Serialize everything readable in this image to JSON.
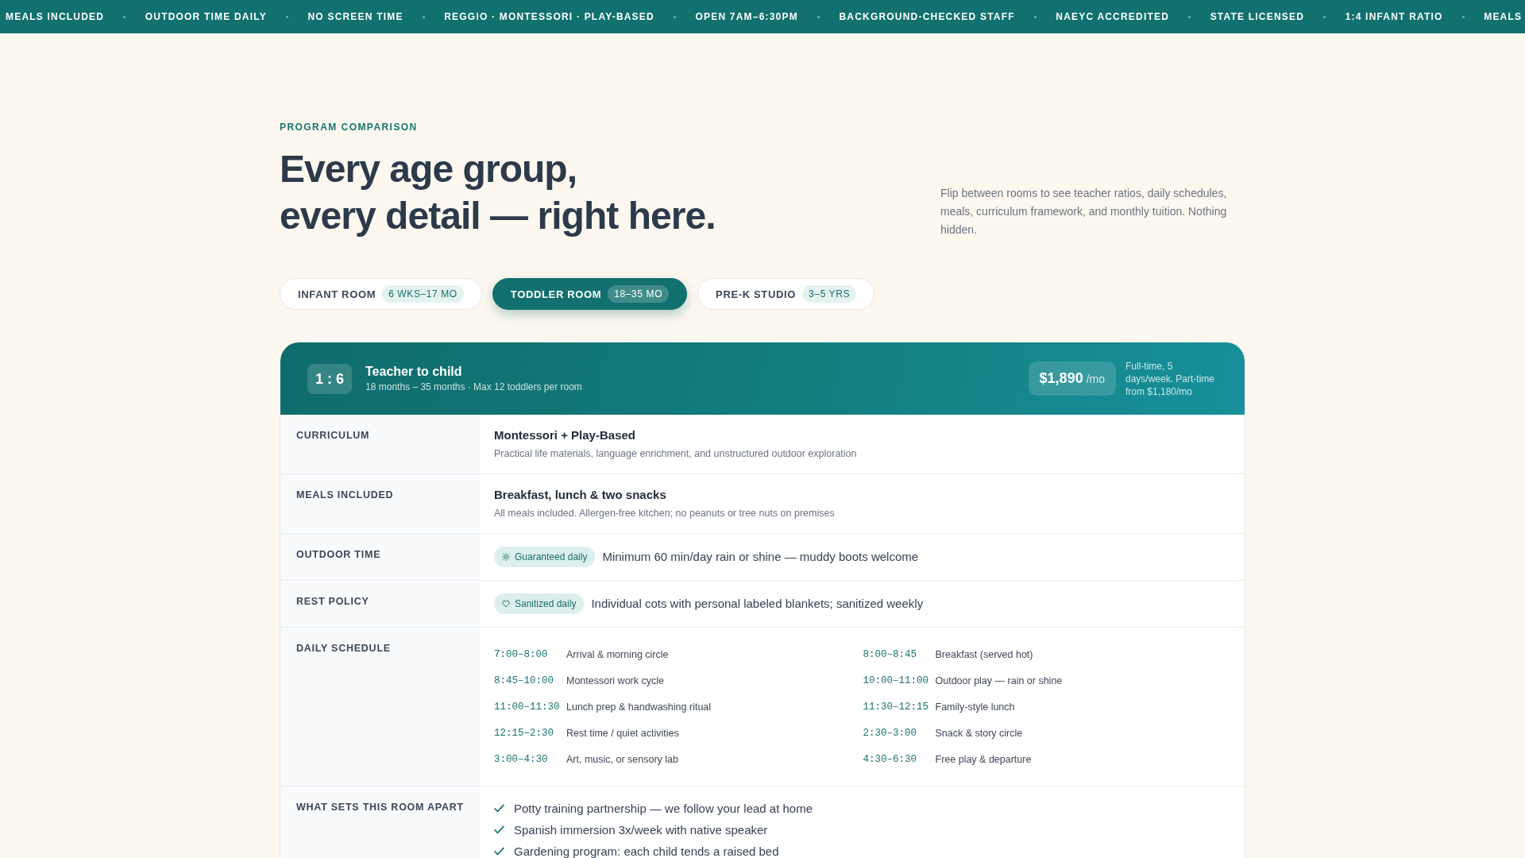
{
  "ticker": {
    "items": [
      "MEALS INCLUDED",
      "OUTDOOR TIME DAILY",
      "NO SCREEN TIME",
      "REGGIO · MONTESSORI · PLAY-BASED",
      "OPEN 7AM–6:30PM",
      "BACKGROUND-CHECKED STAFF",
      "NAEYC ACCREDITED",
      "STATE LICENSED",
      "1:4 INFANT RATIO",
      "MEALS"
    ]
  },
  "header": {
    "eyebrow": "PROGRAM COMPARISON",
    "title_lines": [
      "Every age group,",
      "every detail — right here."
    ],
    "intro": "Flip between rooms to see teacher ratios, daily schedules, meals, curriculum framework, and monthly tuition. Nothing hidden."
  },
  "tabs": [
    {
      "label": "INFANT ROOM",
      "age": "6 WKS–17 MO",
      "selected": false
    },
    {
      "label": "TODDLER ROOM",
      "age": "18–35 MO",
      "selected": true
    },
    {
      "label": "PRE-K STUDIO",
      "age": "3–5 YRS",
      "selected": false
    }
  ],
  "program_card": {
    "ratio": "1 : 6",
    "ratio_title": "Teacher to child",
    "ratio_detail": "18 months – 35 months · Max 12 toddlers per room",
    "price": "$1,890",
    "price_unit": "/mo",
    "price_note": "Full-time, 5 days/week. Part-time from $1,180/mo",
    "rows": [
      {
        "kind": "detail",
        "label": "CURRICULUM",
        "title": "Montessori + Play-Based",
        "detail": "Practical life materials, language enrichment, and unstructured outdoor exploration"
      },
      {
        "kind": "detail",
        "label": "MEALS INCLUDED",
        "title": "Breakfast, lunch & two snacks",
        "detail": "All meals included. Allergen-free kitchen; no peanuts or tree nuts on premises"
      },
      {
        "kind": "tagged",
        "label": "OUTDOOR TIME",
        "tag": "Guaranteed daily",
        "text": "Minimum 60 min/day rain or shine — muddy boots welcome"
      },
      {
        "kind": "tagged",
        "label": "REST POLICY",
        "tag": "Sanitized daily",
        "text": "Individual cots with personal labeled blankets; sanitized weekly"
      },
      {
        "kind": "schedule",
        "label": "DAILY SCHEDULE",
        "items": [
          {
            "time": "7:00–8:00",
            "activity": "Arrival & morning circle"
          },
          {
            "time": "8:00–8:45",
            "activity": "Breakfast (served hot)"
          },
          {
            "time": "8:45–10:00",
            "activity": "Montessori work cycle"
          },
          {
            "time": "10:00–11:00",
            "activity": "Outdoor play — rain or shine"
          },
          {
            "time": "11:00–11:30",
            "activity": "Lunch prep & handwashing ritual"
          },
          {
            "time": "11:30–12:15",
            "activity": "Family-style lunch"
          },
          {
            "time": "12:15–2:30",
            "activity": "Rest time / quiet activities"
          },
          {
            "time": "2:30–3:00",
            "activity": "Snack & story circle"
          },
          {
            "time": "3:00–4:30",
            "activity": "Art, music, or sensory lab"
          },
          {
            "time": "4:30–6:30",
            "activity": "Free play & departure"
          }
        ]
      },
      {
        "kind": "checklist",
        "label": "WHAT SETS THIS ROOM APART",
        "items": [
          "Potty training partnership — we follow your lead at home",
          "Spanish immersion 3x/week with native speaker",
          "Gardening program: each child tends a raised bed"
        ]
      }
    ]
  }
}
